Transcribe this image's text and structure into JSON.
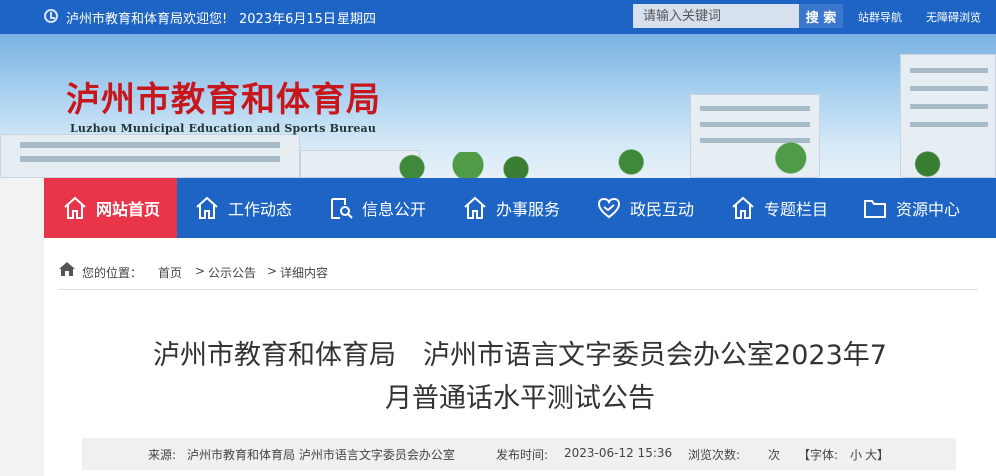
{
  "topbar": {
    "welcome": "泸州市教育和体育局欢迎您!",
    "date": "2023年6月15日",
    "weekday": "星期四",
    "search_placeholder": "请输入关键词",
    "search_button": "搜 索",
    "site_nav": "站群导航",
    "accessibility": "无障碍浏览"
  },
  "banner": {
    "title": "泸州市教育和体育局",
    "subtitle": "Luzhou Municipal Education and Sports Bureau"
  },
  "nav": {
    "items": [
      {
        "label": "网站首页",
        "icon": "home-icon"
      },
      {
        "label": "工作动态",
        "icon": "home-icon"
      },
      {
        "label": "信息公开",
        "icon": "search-doc-icon"
      },
      {
        "label": "办事服务",
        "icon": "home-icon"
      },
      {
        "label": "政民互动",
        "icon": "heart-icon"
      },
      {
        "label": "专题栏目",
        "icon": "home-icon"
      },
      {
        "label": "资源中心",
        "icon": "folder-icon"
      }
    ]
  },
  "breadcrumb": {
    "prefix": "您的位置：",
    "items": [
      "首页",
      "公示公告",
      "详细内容"
    ],
    "separator": ">"
  },
  "article": {
    "title_line1": "泸州市教育和体育局　泸州市语言文字委员会办公室2023年7",
    "title_line2": "月普通话水平测试公告",
    "source_label": "来源:",
    "source": "泸州市教育和体育局 泸州市语言文字委员会办公室",
    "publish_label": "发布时间:",
    "publish_time": "2023-06-12 15:36",
    "views_label": "浏览次数:",
    "views_unit": "次",
    "font_label": "【字体:",
    "font_small": "小",
    "font_large": "大】"
  },
  "colors": {
    "primary": "#1d64c4",
    "active_nav": "#e8354a",
    "title_red": "#c8161d"
  }
}
